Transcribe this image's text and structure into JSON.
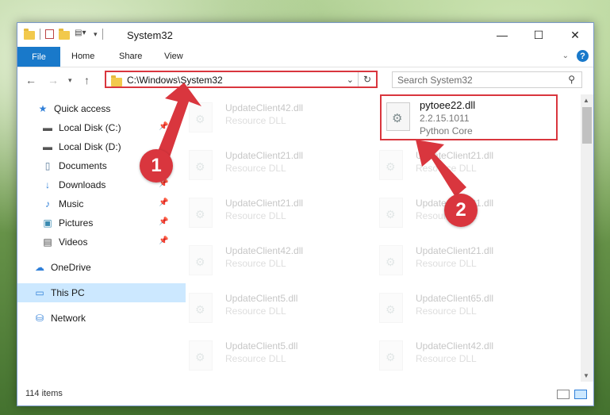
{
  "window": {
    "title": "System32"
  },
  "ribbon": {
    "file": "File",
    "home": "Home",
    "share": "Share",
    "view": "View"
  },
  "address": {
    "path": "C:\\Windows\\System32"
  },
  "search": {
    "placeholder": "Search System32"
  },
  "nav": {
    "items": [
      {
        "label": "Quick access",
        "icon": "star-icon"
      },
      {
        "label": "Local Disk (C:)",
        "icon": "drive-icon"
      },
      {
        "label": "Local Disk (D:)",
        "icon": "drive-icon"
      },
      {
        "label": "Documents",
        "icon": "documents-icon"
      },
      {
        "label": "Downloads",
        "icon": "download-icon"
      },
      {
        "label": "Music",
        "icon": "music-icon"
      },
      {
        "label": "Pictures",
        "icon": "pictures-icon"
      },
      {
        "label": "Videos",
        "icon": "videos-icon"
      },
      {
        "label": "OneDrive",
        "icon": "cloud-icon"
      },
      {
        "label": "This PC",
        "icon": "pc-icon"
      },
      {
        "label": "Network",
        "icon": "network-icon"
      }
    ]
  },
  "files": {
    "left": [
      {
        "name": "UpdateClient42.dll",
        "type": "Resource DLL"
      },
      {
        "name": "UpdateClient21.dll",
        "type": "Resource DLL"
      },
      {
        "name": "UpdateClient21.dll",
        "type": "Resource DLL"
      },
      {
        "name": "UpdateClient42.dll",
        "type": "Resource DLL"
      },
      {
        "name": "UpdateClient5.dll",
        "type": "Resource DLL"
      },
      {
        "name": "UpdateClient5.dll",
        "type": "Resource DLL"
      }
    ],
    "right": [
      {
        "name": "UpdateClient21.dll",
        "type": "Resource DLL"
      },
      {
        "name": "UpdateClient21.dll",
        "type": "Resource DLL"
      },
      {
        "name": "UpdateClient21.dll",
        "type": "Resource DLL"
      },
      {
        "name": "UpdateClient65.dll",
        "type": "Resource DLL"
      },
      {
        "name": "UpdateClient42.dll",
        "type": "Resource DLL"
      }
    ],
    "selected": {
      "name": "pytoee22.dll",
      "version": "2.2.15.1011",
      "description": "Python Core"
    }
  },
  "status": {
    "count": "114 items"
  },
  "annotations": {
    "one": "1",
    "two": "2",
    "color": "#d9363e"
  }
}
